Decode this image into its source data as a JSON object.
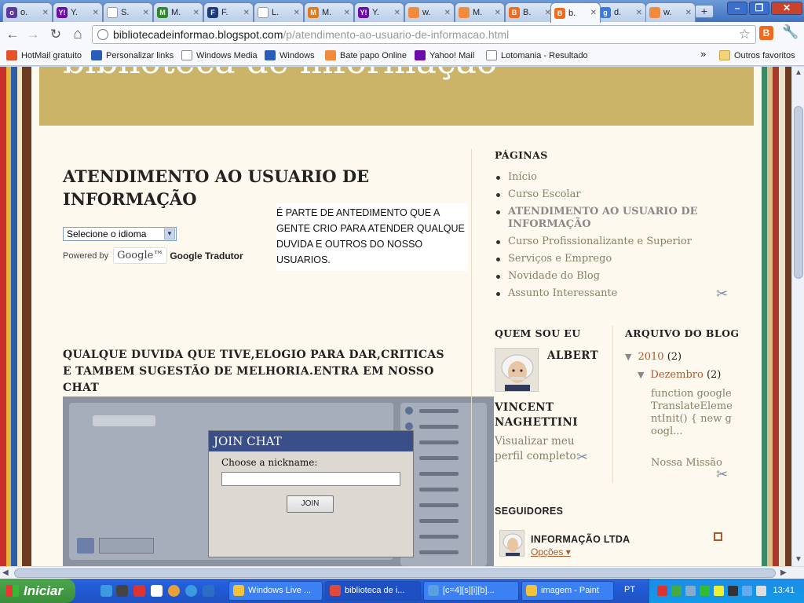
{
  "browser": {
    "tabs": [
      {
        "label": "o.",
        "fav": "#5b3aa0",
        "glyph": "o"
      },
      {
        "label": "Y.",
        "fav": "#6b0ba8",
        "glyph": "Y!"
      },
      {
        "label": "S.",
        "fav": "#ffffff",
        "glyph": ""
      },
      {
        "label": "M.",
        "fav": "#2c8a2c",
        "glyph": "M"
      },
      {
        "label": "F.",
        "fav": "#1c3d7a",
        "glyph": "F"
      },
      {
        "label": "L.",
        "fav": "#ffffff",
        "glyph": ""
      },
      {
        "label": "M.",
        "fav": "#e07a1a",
        "glyph": "M"
      },
      {
        "label": "Y.",
        "fav": "#6b0ba8",
        "glyph": "Y!"
      },
      {
        "label": "w.",
        "fav": "#f08a3c",
        "glyph": ""
      },
      {
        "label": "M.",
        "fav": "#f08a3c",
        "glyph": ""
      },
      {
        "label": "B.",
        "fav": "#f26a1b",
        "glyph": "B"
      },
      {
        "label": "b.",
        "fav": "#f26a1b",
        "glyph": "B"
      },
      {
        "label": "d.",
        "fav": "#3a7ae0",
        "glyph": "g"
      },
      {
        "label": "w.",
        "fav": "#f08a3c",
        "glyph": ""
      }
    ],
    "new_tab": "+",
    "window_controls": {
      "minimize": "–",
      "maximize": "❐",
      "close": "✕"
    },
    "nav": {
      "back": "←",
      "forward": "→",
      "reload": "↻",
      "home": "⌂"
    },
    "url_host": "bibliotecadeinformao.blogspot.com",
    "url_path": "/p/atendimento-ao-usuario-de-informacao.html",
    "bookmarks": [
      {
        "label": "HotMail gratuito",
        "color": "#e5532d"
      },
      {
        "label": "Personalizar links",
        "color": "#2a5db8"
      },
      {
        "label": "Windows Media",
        "color": "#ffffff"
      },
      {
        "label": "Windows",
        "color": "#2a5db8"
      },
      {
        "label": "Bate papo Online",
        "color": "#f08a3c"
      },
      {
        "label": "Yahoo! Mail",
        "color": "#6b0ba8"
      },
      {
        "label": "Lotomania - Resultado",
        "color": "#ffffff"
      }
    ],
    "bookmarks_overflow": "»",
    "other_bookmarks": "Outros favoritos"
  },
  "blog": {
    "title": "biblioteca de informação",
    "post_title": "ATENDIMENTO AO USUARIO DE INFORMAÇÃO",
    "translate": {
      "select_value": "Selecione o idioma",
      "powered_by": "Powered by",
      "google": "Google™",
      "translator": "Google Tradutor"
    },
    "description": "É PARTE DE ANTEDIMENTO QUE A GENTE CRIO PARA ATENDER QUALQUE DUVIDA E OUTROS DO NOSSO USUARIOS.",
    "chat_heading": "QUALQUE DUVIDA QUE TIVE,ELOGIO PARA DAR,CRITICAS E TAMBEM SUGESTÃO DE MELHORIA.ENTRA EM NOSSO CHAT",
    "chat": {
      "dialog_title": "JOIN CHAT",
      "nickname_label": "Choose a nickname:",
      "nickname_value": "",
      "join_button": "JOIN"
    }
  },
  "sidebar": {
    "pages_title": "PÁGINAS",
    "pages": [
      {
        "label": "Início",
        "current": false
      },
      {
        "label": "Curso Escolar",
        "current": false
      },
      {
        "label": "ATENDIMENTO AO USUARIO DE INFORMAÇÃO",
        "current": true
      },
      {
        "label": "Curso Profissionalizante e Superior",
        "current": false
      },
      {
        "label": "Serviços e Emprego",
        "current": false
      },
      {
        "label": "Novidade do Blog",
        "current": false
      },
      {
        "label": "Assunto Interessante",
        "current": false
      }
    ],
    "about_title": "QUEM SOU EU",
    "about_name_first": "ALBERT",
    "about_name_rest": "VINCENT NAGHETTINI",
    "about_link": "Visualizar meu perfil completo",
    "archive_title": "ARQUIVO DO BLOG",
    "archive_year": "2010",
    "archive_year_count": "(2)",
    "archive_month": "Dezembro",
    "archive_month_count": "(2)",
    "archive_post1": "function googleTranslateElementInit() { new googl...",
    "archive_post2": "Nossa Missão",
    "followers_title": "SEGUIDORES",
    "follower_name": "INFORMAÇÃO LTDA",
    "follower_options": "Opções"
  },
  "taskbar": {
    "start_label": "Iniciar",
    "items": [
      {
        "label": "Windows Live ...",
        "active": false,
        "color": "#f2c23b"
      },
      {
        "label": "biblioteca de i...",
        "active": true,
        "color": "#e04a3a"
      },
      {
        "label": "[c=4][s][i][b]...",
        "active": false,
        "color": "#5aa0e0"
      },
      {
        "label": "imagem - Paint",
        "active": false,
        "color": "#f2c23b"
      }
    ],
    "language": "PT",
    "clock": "13:41"
  }
}
